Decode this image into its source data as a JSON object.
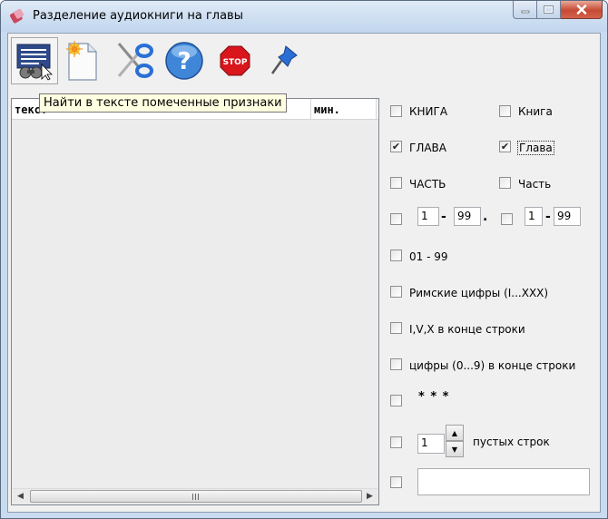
{
  "window": {
    "title": "Разделение аудиокниги на главы"
  },
  "toolbar": {
    "buttons": [
      {
        "name": "find-markers",
        "icon": "search-text-icon"
      },
      {
        "name": "new-document",
        "icon": "new-document-icon"
      },
      {
        "name": "split",
        "icon": "scissors-icon"
      },
      {
        "name": "help",
        "icon": "help-icon"
      },
      {
        "name": "stop",
        "icon": "stop-sign-icon",
        "text": "STOP"
      },
      {
        "name": "pin",
        "icon": "pushpin-icon"
      }
    ],
    "tooltip": "Найти в тексте помеченные признаки"
  },
  "list": {
    "columns": [
      "текст",
      "мин."
    ]
  },
  "options": {
    "kniga_upper": {
      "label": "КНИГА",
      "checked": false
    },
    "kniga_lower": {
      "label": "Книга",
      "checked": false
    },
    "glava_upper": {
      "label": "ГЛАВА",
      "checked": true
    },
    "glava_lower": {
      "label": "Глава",
      "checked": true
    },
    "chast_upper": {
      "label": "ЧАСТЬ",
      "checked": false
    },
    "chast_lower": {
      "label": "Часть",
      "checked": false
    },
    "range1": {
      "from": "1",
      "to": "99",
      "dash": "-",
      "dot": ".",
      "checked": false
    },
    "range2": {
      "from": "1",
      "to": "99",
      "dash": "-",
      "checked": false
    },
    "digits_01_99": {
      "label": "01 - 99",
      "checked": false
    },
    "roman": {
      "label": "Римские цифры (I...XXX)",
      "checked": false
    },
    "ivx_end": {
      "label": "I,V,X в конце строки",
      "checked": false
    },
    "digits_end": {
      "label": "цифры (0...9) в конце строки",
      "checked": false
    },
    "stars": {
      "label": "* * *",
      "checked": false
    },
    "empty_lines": {
      "value": "1",
      "label": "пустых строк",
      "checked": false
    },
    "custom": {
      "value": "",
      "checked": false
    }
  },
  "colors": {
    "close_button": "#c64a34",
    "tooltip_bg": "#ffffe1",
    "frame": "#c9dcef"
  }
}
